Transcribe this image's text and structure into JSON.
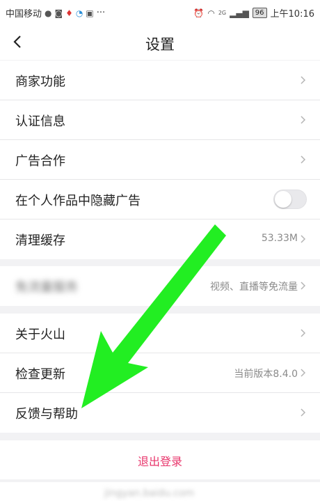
{
  "status_bar": {
    "carrier": "中国移动",
    "more": "···",
    "network": "2G",
    "battery": "96",
    "time": "上午10:16"
  },
  "header": {
    "title": "设置"
  },
  "group1": {
    "items": [
      {
        "label": "商家功能",
        "value": ""
      },
      {
        "label": "认证信息",
        "value": ""
      },
      {
        "label": "广告合作",
        "value": ""
      },
      {
        "label": "在个人作品中隐藏广告",
        "toggle": false
      },
      {
        "label": "清理缓存",
        "value": "53.33M"
      }
    ]
  },
  "group2": {
    "items": [
      {
        "label": "免流量服务",
        "value": "视频、直播等免流量"
      }
    ]
  },
  "group3": {
    "items": [
      {
        "label": "关于火山",
        "value": ""
      },
      {
        "label": "检查更新",
        "value": "当前版本8.4.0"
      },
      {
        "label": "反馈与帮助",
        "value": ""
      }
    ]
  },
  "logout": {
    "label": "退出登录"
  },
  "watermark": {
    "text": "jingyan.baidu.com"
  },
  "colors": {
    "accent": "#e8356b",
    "annotation_arrow": "#22ee22",
    "background": "#f2f2f4"
  }
}
